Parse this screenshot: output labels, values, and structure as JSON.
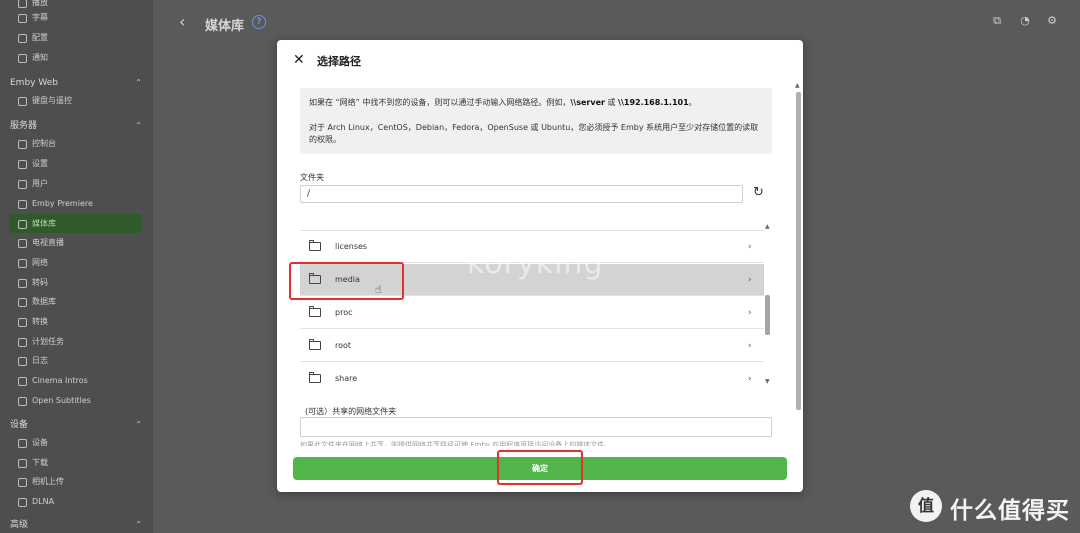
{
  "sidebar": {
    "items_top": [
      {
        "label": "播放",
        "icon": "play-icon"
      },
      {
        "label": "字幕",
        "icon": "subtitles-icon"
      },
      {
        "label": "配置",
        "icon": "profile-icon"
      },
      {
        "label": "通知",
        "icon": "bell-icon"
      }
    ],
    "emby_web": {
      "heading": "Emby Web",
      "items": [
        {
          "label": "键盘与遥控",
          "icon": "keyboard-icon"
        }
      ]
    },
    "server": {
      "heading": "服务器",
      "items": [
        {
          "label": "控制台",
          "icon": "dashboard-icon"
        },
        {
          "label": "设置",
          "icon": "gear-icon"
        },
        {
          "label": "用户",
          "icon": "users-icon"
        },
        {
          "label": "Emby Premiere",
          "icon": "star-icon"
        },
        {
          "label": "媒体库",
          "icon": "folder-icon"
        },
        {
          "label": "电视直播",
          "icon": "tv-icon"
        },
        {
          "label": "网络",
          "icon": "wifi-icon"
        },
        {
          "label": "转码",
          "icon": "transcode-icon"
        },
        {
          "label": "数据库",
          "icon": "database-icon"
        },
        {
          "label": "转换",
          "icon": "convert-icon"
        },
        {
          "label": "计划任务",
          "icon": "clock-icon"
        },
        {
          "label": "日志",
          "icon": "log-icon"
        },
        {
          "label": "Cinema Intros",
          "icon": "film-icon"
        },
        {
          "label": "Open Subtitles",
          "icon": "subtitle-icon"
        }
      ]
    },
    "devices": {
      "heading": "设备",
      "items": [
        {
          "label": "设备",
          "icon": "device-icon"
        },
        {
          "label": "下载",
          "icon": "download-icon"
        },
        {
          "label": "相机上传",
          "icon": "camera-icon"
        },
        {
          "label": "DLNA",
          "icon": "dlna-icon"
        }
      ]
    },
    "advanced": {
      "heading": "高级"
    }
  },
  "topbar": {
    "back": "‹",
    "title": "媒体库",
    "help": "?",
    "cast_icon": "⧉",
    "user_icon": "◔",
    "settings_icon": "⚙"
  },
  "modal": {
    "close": "✕",
    "title": "选择路径",
    "info_prefix": "如果在 “网络” 中找不到您的设备，则可以通过手动输入网络路径。例如，",
    "info_server": "\\\\server",
    "info_or": " 或 ",
    "info_ip": "\\\\192.168.1.101",
    "info_suffix": "。",
    "info_line2": "对于 Arch Linux，CentOS，Debian，Fedora，OpenSuse 或 Ubuntu，您必须授予 Emby 系统用户至少对存储位置的读取的权限。",
    "folder_label": "文件夹",
    "folder_value": "/",
    "refresh_icon": "↻",
    "rows": [
      {
        "label": "licenses",
        "selected": false
      },
      {
        "label": "media",
        "selected": true
      },
      {
        "label": "proc",
        "selected": false
      },
      {
        "label": "root",
        "selected": false
      },
      {
        "label": "share",
        "selected": false
      }
    ],
    "row_arrow": "›",
    "share_label": "(可选）共享的网络文件夹",
    "hint": "如果此文件夹在网络上共享，则提供网络共享路径可使 Emby 应用程序直接访问设备上的媒体文件。",
    "ok_label": "确定"
  },
  "watermark": "koryking",
  "brand": {
    "logo": "值",
    "text": "什么值得买"
  }
}
